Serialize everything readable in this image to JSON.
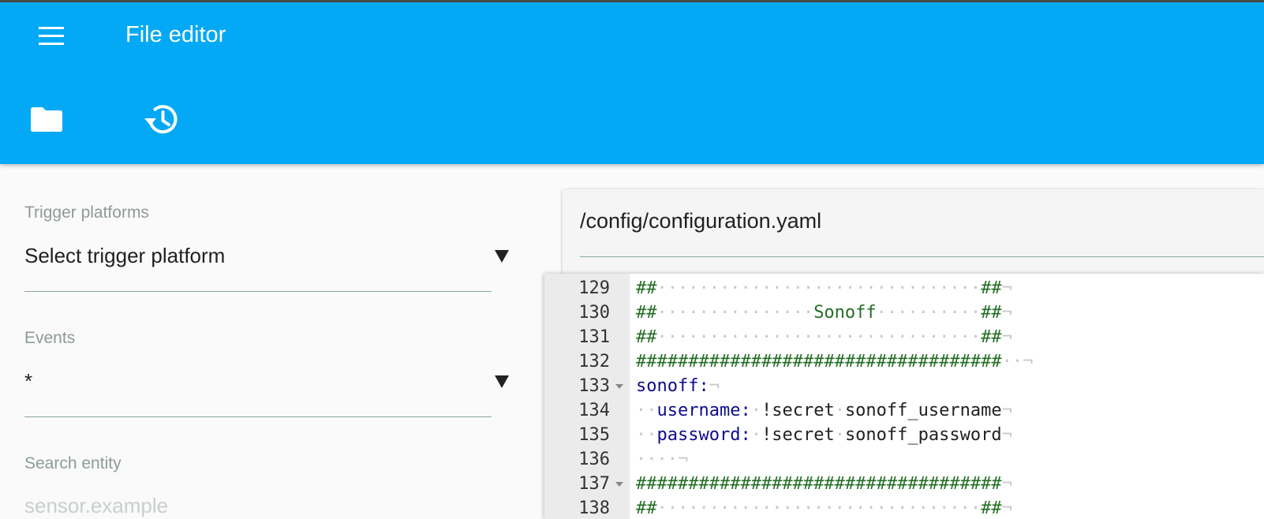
{
  "app_title": "File editor",
  "toolbar": {
    "folder_icon": "folder-icon",
    "history_icon": "history-icon"
  },
  "left_panel": {
    "trigger": {
      "label": "Trigger platforms",
      "value": "Select trigger platform"
    },
    "events": {
      "label": "Events",
      "value": "*"
    },
    "search": {
      "label": "Search entity",
      "placeholder": "sensor.example"
    }
  },
  "editor": {
    "file_path": "/config/configuration.yaml",
    "lines": [
      {
        "num": "129",
        "tokens": [
          {
            "t": "##",
            "c": "c"
          },
          {
            "t": "·······························",
            "c": "ws"
          },
          {
            "t": "##",
            "c": "c"
          },
          {
            "t": "¬",
            "c": "ws"
          }
        ]
      },
      {
        "num": "130",
        "tokens": [
          {
            "t": "##",
            "c": "c"
          },
          {
            "t": "···············",
            "c": "ws"
          },
          {
            "t": "Sonoff",
            "c": "c"
          },
          {
            "t": "··········",
            "c": "ws"
          },
          {
            "t": "##",
            "c": "c"
          },
          {
            "t": "¬",
            "c": "ws"
          }
        ]
      },
      {
        "num": "131",
        "tokens": [
          {
            "t": "##",
            "c": "c"
          },
          {
            "t": "·······························",
            "c": "ws"
          },
          {
            "t": "##",
            "c": "c"
          },
          {
            "t": "¬",
            "c": "ws"
          }
        ]
      },
      {
        "num": "132",
        "tokens": [
          {
            "t": "###################################",
            "c": "c"
          },
          {
            "t": "··¬",
            "c": "ws"
          }
        ]
      },
      {
        "num": "133",
        "fold": true,
        "tokens": [
          {
            "t": "sonoff:",
            "c": "k"
          },
          {
            "t": "¬",
            "c": "ws"
          }
        ]
      },
      {
        "num": "134",
        "tokens": [
          {
            "t": "··",
            "c": "ws"
          },
          {
            "t": "username:",
            "c": "k"
          },
          {
            "t": "·",
            "c": "ws"
          },
          {
            "t": "!secret",
            "c": "v"
          },
          {
            "t": "·",
            "c": "ws"
          },
          {
            "t": "sonoff_username",
            "c": "v"
          },
          {
            "t": "¬",
            "c": "ws"
          }
        ]
      },
      {
        "num": "135",
        "tokens": [
          {
            "t": "··",
            "c": "ws"
          },
          {
            "t": "password:",
            "c": "k"
          },
          {
            "t": "·",
            "c": "ws"
          },
          {
            "t": "!secret",
            "c": "v"
          },
          {
            "t": "·",
            "c": "ws"
          },
          {
            "t": "sonoff_password",
            "c": "v"
          },
          {
            "t": "¬",
            "c": "ws"
          }
        ]
      },
      {
        "num": "136",
        "tokens": [
          {
            "t": "····¬",
            "c": "ws"
          }
        ]
      },
      {
        "num": "137",
        "fold": true,
        "tokens": [
          {
            "t": "###################################",
            "c": "c"
          },
          {
            "t": "¬",
            "c": "ws"
          }
        ]
      },
      {
        "num": "138",
        "tokens": [
          {
            "t": "##",
            "c": "c"
          },
          {
            "t": "·······························",
            "c": "ws"
          },
          {
            "t": "##",
            "c": "c"
          },
          {
            "t": "¬",
            "c": "ws"
          }
        ]
      }
    ]
  }
}
